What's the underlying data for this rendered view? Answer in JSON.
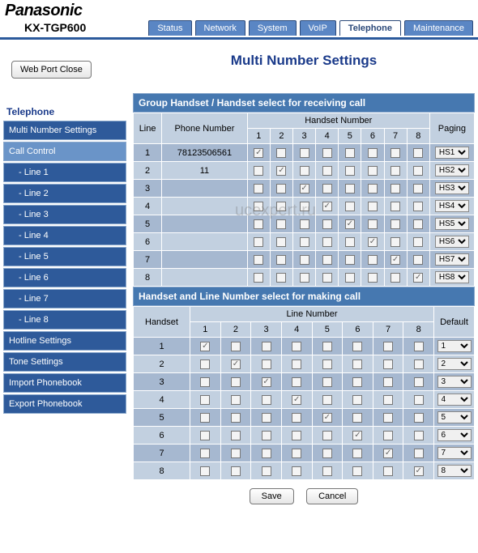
{
  "brand": "Panasonic",
  "model": "KX-TGP600",
  "tabs": [
    "Status",
    "Network",
    "System",
    "VoIP",
    "Telephone",
    "Maintenance"
  ],
  "active_tab": 4,
  "web_port_close": "Web Port Close",
  "side_title": "Telephone",
  "sidebar": [
    {
      "label": "Multi Number Settings",
      "type": "item"
    },
    {
      "label": "Call Control",
      "type": "light"
    },
    {
      "label": "- Line 1",
      "type": "sub"
    },
    {
      "label": "- Line 2",
      "type": "sub"
    },
    {
      "label": "- Line 3",
      "type": "sub"
    },
    {
      "label": "- Line 4",
      "type": "sub"
    },
    {
      "label": "- Line 5",
      "type": "sub"
    },
    {
      "label": "- Line 6",
      "type": "sub"
    },
    {
      "label": "- Line 7",
      "type": "sub"
    },
    {
      "label": "- Line 8",
      "type": "sub"
    },
    {
      "label": "Hotline Settings",
      "type": "item"
    },
    {
      "label": "Tone Settings",
      "type": "item"
    },
    {
      "label": "Import Phonebook",
      "type": "item"
    },
    {
      "label": "Export Phonebook",
      "type": "item"
    }
  ],
  "page_title": "Multi Number Settings",
  "section1_title": "Group Handset / Handset select for receiving call",
  "section2_title": "Handset and Line Number select for making call",
  "col_line": "Line",
  "col_phone": "Phone Number",
  "col_hsnum": "Handset Number",
  "col_paging": "Paging",
  "col_handset": "Handset",
  "col_linenum": "Line Number",
  "col_default": "Default",
  "nums": [
    "1",
    "2",
    "3",
    "4",
    "5",
    "6",
    "7",
    "8"
  ],
  "receiving": [
    {
      "line": "1",
      "phone": "78123506561",
      "hs": [
        true,
        false,
        false,
        false,
        false,
        false,
        false,
        false
      ],
      "paging": "HS1"
    },
    {
      "line": "2",
      "phone": "11",
      "hs": [
        false,
        true,
        false,
        false,
        false,
        false,
        false,
        false
      ],
      "paging": "HS2"
    },
    {
      "line": "3",
      "phone": "",
      "hs": [
        false,
        false,
        true,
        false,
        false,
        false,
        false,
        false
      ],
      "paging": "HS3"
    },
    {
      "line": "4",
      "phone": "",
      "hs": [
        false,
        false,
        false,
        true,
        false,
        false,
        false,
        false
      ],
      "paging": "HS4"
    },
    {
      "line": "5",
      "phone": "",
      "hs": [
        false,
        false,
        false,
        false,
        true,
        false,
        false,
        false
      ],
      "paging": "HS5"
    },
    {
      "line": "6",
      "phone": "",
      "hs": [
        false,
        false,
        false,
        false,
        false,
        true,
        false,
        false
      ],
      "paging": "HS6"
    },
    {
      "line": "7",
      "phone": "",
      "hs": [
        false,
        false,
        false,
        false,
        false,
        false,
        true,
        false
      ],
      "paging": "HS7"
    },
    {
      "line": "8",
      "phone": "",
      "hs": [
        false,
        false,
        false,
        false,
        false,
        false,
        false,
        true
      ],
      "paging": "HS8"
    }
  ],
  "making": [
    {
      "handset": "1",
      "ln": [
        true,
        false,
        false,
        false,
        false,
        false,
        false,
        false
      ],
      "default": "1"
    },
    {
      "handset": "2",
      "ln": [
        false,
        true,
        false,
        false,
        false,
        false,
        false,
        false
      ],
      "default": "2"
    },
    {
      "handset": "3",
      "ln": [
        false,
        false,
        true,
        false,
        false,
        false,
        false,
        false
      ],
      "default": "3"
    },
    {
      "handset": "4",
      "ln": [
        false,
        false,
        false,
        true,
        false,
        false,
        false,
        false
      ],
      "default": "4"
    },
    {
      "handset": "5",
      "ln": [
        false,
        false,
        false,
        false,
        true,
        false,
        false,
        false
      ],
      "default": "5"
    },
    {
      "handset": "6",
      "ln": [
        false,
        false,
        false,
        false,
        false,
        true,
        false,
        false
      ],
      "default": "6"
    },
    {
      "handset": "7",
      "ln": [
        false,
        false,
        false,
        false,
        false,
        false,
        true,
        false
      ],
      "default": "7"
    },
    {
      "handset": "8",
      "ln": [
        false,
        false,
        false,
        false,
        false,
        false,
        false,
        true
      ],
      "default": "8"
    }
  ],
  "save_label": "Save",
  "cancel_label": "Cancel",
  "watermark": "ucexpert.ru"
}
